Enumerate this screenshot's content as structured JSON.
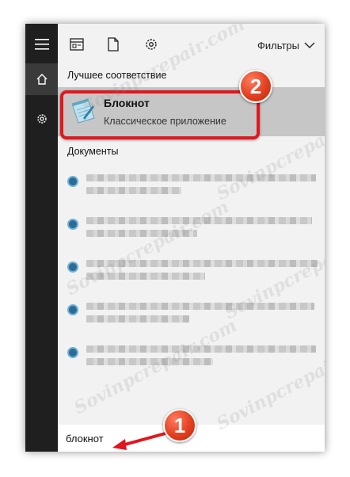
{
  "toolbar": {
    "filters_label": "Фильтры"
  },
  "sections": {
    "best_match": "Лучшее соответствие",
    "documents": "Документы"
  },
  "best_match": {
    "title": "Блокнот",
    "subtitle": "Классическое приложение"
  },
  "search": {
    "value": "блокнот"
  },
  "annotations": {
    "step1": "1",
    "step2": "2"
  },
  "watermark": "Sovinpcrepair.com",
  "colors": {
    "rail": "#1f1f1f",
    "panel": "#f2f2f2",
    "highlight": "#e2161e",
    "selected": "#c6c6c6"
  }
}
